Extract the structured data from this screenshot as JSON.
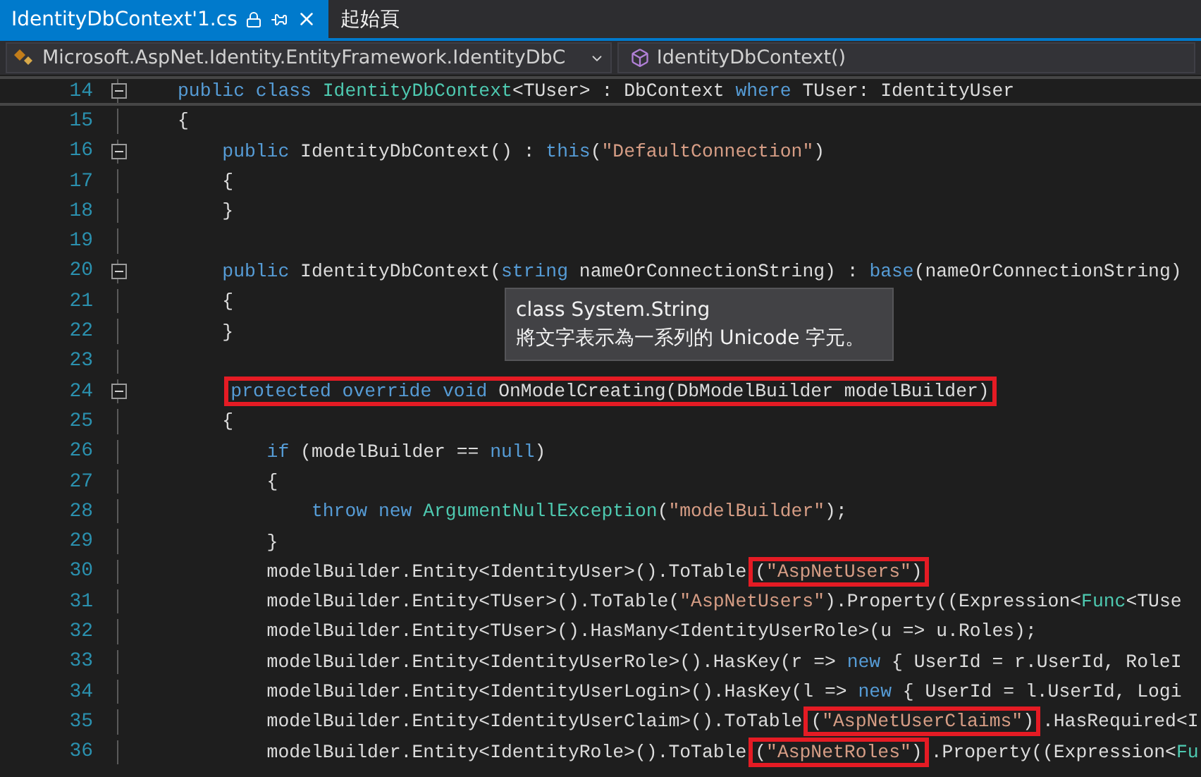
{
  "tabs": [
    {
      "label": "IdentityDbContext'1.cs",
      "selected": true
    },
    {
      "label": "起始頁",
      "selected": false
    }
  ],
  "navigation_bar": {
    "scope": "Microsoft.AspNet.Identity.EntityFramework.IdentityDbC",
    "member": "IdentityDbContext()"
  },
  "lines": [
    {
      "number": "14",
      "foldable": true,
      "current": true,
      "segments": [
        {
          "kind": "text",
          "tokens": [
            {
              "kind": "keyword",
              "text": "public class "
            },
            {
              "kind": "type",
              "text": "IdentityDbContext"
            },
            {
              "kind": "plain",
              "text": "<TUser> : DbContext "
            },
            {
              "kind": "keyword",
              "text": "where"
            },
            {
              "kind": "plain",
              "text": " TUser: IdentityUser"
            }
          ]
        }
      ]
    },
    {
      "number": "15",
      "foldable": false,
      "current": false,
      "segments": [
        {
          "kind": "text",
          "tokens": [
            {
              "kind": "plain",
              "text": "{"
            }
          ]
        }
      ]
    },
    {
      "number": "16",
      "foldable": true,
      "current": false,
      "segments": [
        {
          "kind": "text",
          "tokens": [
            {
              "kind": "keyword",
              "text": "    public"
            },
            {
              "kind": "plain",
              "text": " IdentityDbContext() : "
            },
            {
              "kind": "keyword",
              "text": "this"
            },
            {
              "kind": "plain",
              "text": "("
            },
            {
              "kind": "string",
              "text": "\"DefaultConnection\""
            },
            {
              "kind": "plain",
              "text": ")"
            }
          ]
        }
      ]
    },
    {
      "number": "17",
      "foldable": false,
      "current": false,
      "segments": [
        {
          "kind": "text",
          "tokens": [
            {
              "kind": "plain",
              "text": "    {"
            }
          ]
        }
      ]
    },
    {
      "number": "18",
      "foldable": false,
      "current": false,
      "segments": [
        {
          "kind": "text",
          "tokens": [
            {
              "kind": "plain",
              "text": "    }"
            }
          ]
        }
      ]
    },
    {
      "number": "19",
      "foldable": false,
      "current": false
    },
    {
      "number": "20",
      "foldable": true,
      "current": false,
      "segments": [
        {
          "kind": "text",
          "tokens": [
            {
              "kind": "keyword",
              "text": "    public"
            },
            {
              "kind": "plain",
              "text": " IdentityDbContext("
            },
            {
              "kind": "keyword",
              "text": "string"
            },
            {
              "kind": "plain",
              "text": " nameOrConnectionString) : "
            },
            {
              "kind": "keyword",
              "text": "base"
            },
            {
              "kind": "plain",
              "text": "(nameOrConnectionString)"
            }
          ]
        }
      ]
    },
    {
      "number": "21",
      "foldable": false,
      "current": false,
      "segments": [
        {
          "kind": "text",
          "tokens": [
            {
              "kind": "plain",
              "text": "    {"
            }
          ]
        }
      ]
    },
    {
      "number": "22",
      "foldable": false,
      "current": false,
      "segments": [
        {
          "kind": "text",
          "tokens": [
            {
              "kind": "plain",
              "text": "    }"
            }
          ]
        }
      ]
    },
    {
      "number": "23",
      "foldable": false,
      "current": false
    },
    {
      "number": "24",
      "foldable": true,
      "current": false,
      "segments": [
        {
          "kind": "highlight",
          "tokens": [
            {
              "kind": "keyword",
              "text": "    protected override void"
            },
            {
              "kind": "plain",
              "text": " OnModelCreating(DbModelBuilder modelBuilder)"
            }
          ]
        }
      ]
    },
    {
      "number": "25",
      "foldable": false,
      "current": false,
      "segments": [
        {
          "kind": "text",
          "tokens": [
            {
              "kind": "plain",
              "text": "    {"
            }
          ]
        }
      ]
    },
    {
      "number": "26",
      "foldable": false,
      "current": false,
      "segments": [
        {
          "kind": "text",
          "tokens": [
            {
              "kind": "keyword",
              "text": "        if"
            },
            {
              "kind": "plain",
              "text": " (modelBuilder == "
            },
            {
              "kind": "keyword",
              "text": "null"
            },
            {
              "kind": "plain",
              "text": ")"
            }
          ]
        }
      ]
    },
    {
      "number": "27",
      "foldable": false,
      "current": false,
      "segments": [
        {
          "kind": "text",
          "tokens": [
            {
              "kind": "plain",
              "text": "        {"
            }
          ]
        }
      ]
    },
    {
      "number": "28",
      "foldable": false,
      "current": false,
      "segments": [
        {
          "kind": "text",
          "tokens": [
            {
              "kind": "keyword",
              "text": "            throw new "
            },
            {
              "kind": "type",
              "text": "ArgumentNullException"
            },
            {
              "kind": "plain",
              "text": "("
            },
            {
              "kind": "string",
              "text": "\"modelBuilder\""
            },
            {
              "kind": "plain",
              "text": ");"
            }
          ]
        }
      ]
    },
    {
      "number": "29",
      "foldable": false,
      "current": false,
      "segments": [
        {
          "kind": "text",
          "tokens": [
            {
              "kind": "plain",
              "text": "        }"
            }
          ]
        }
      ]
    },
    {
      "number": "30",
      "foldable": false,
      "current": false,
      "segments": [
        {
          "kind": "text",
          "tokens": [
            {
              "kind": "plain",
              "text": "        modelBuilder.Entity<IdentityUser>().ToTable"
            }
          ]
        },
        {
          "kind": "highlight",
          "tokens": [
            {
              "kind": "plain",
              "text": "("
            },
            {
              "kind": "string",
              "text": "\"AspNetUsers\""
            },
            {
              "kind": "plain",
              "text": ")"
            }
          ]
        }
      ]
    },
    {
      "number": "31",
      "foldable": false,
      "current": false,
      "segments": [
        {
          "kind": "text",
          "tokens": [
            {
              "kind": "plain",
              "text": "        modelBuilder.Entity<TUser>().ToTable("
            },
            {
              "kind": "string",
              "text": "\"AspNetUsers\""
            },
            {
              "kind": "plain",
              "text": ").Property((Expression<"
            },
            {
              "kind": "type",
              "text": "Func"
            },
            {
              "kind": "plain",
              "text": "<TUse"
            }
          ]
        }
      ]
    },
    {
      "number": "32",
      "foldable": false,
      "current": false,
      "segments": [
        {
          "kind": "text",
          "tokens": [
            {
              "kind": "plain",
              "text": "        modelBuilder.Entity<TUser>().HasMany<IdentityUserRole>(u => u.Roles);"
            }
          ]
        }
      ]
    },
    {
      "number": "33",
      "foldable": false,
      "current": false,
      "segments": [
        {
          "kind": "text",
          "tokens": [
            {
              "kind": "plain",
              "text": "        modelBuilder.Entity<IdentityUserRole>().HasKey(r => "
            },
            {
              "kind": "keyword",
              "text": "new"
            },
            {
              "kind": "plain",
              "text": " { UserId = r.UserId, RoleI"
            }
          ]
        }
      ]
    },
    {
      "number": "34",
      "foldable": false,
      "current": false,
      "segments": [
        {
          "kind": "text",
          "tokens": [
            {
              "kind": "plain",
              "text": "        modelBuilder.Entity<IdentityUserLogin>().HasKey(l => "
            },
            {
              "kind": "keyword",
              "text": "new"
            },
            {
              "kind": "plain",
              "text": " { UserId = l.UserId, Logi"
            }
          ]
        }
      ]
    },
    {
      "number": "35",
      "foldable": false,
      "current": false,
      "segments": [
        {
          "kind": "text",
          "tokens": [
            {
              "kind": "plain",
              "text": "        modelBuilder.Entity<IdentityUserClaim>().ToTable"
            }
          ]
        },
        {
          "kind": "highlight",
          "tokens": [
            {
              "kind": "plain",
              "text": "("
            },
            {
              "kind": "string",
              "text": "\"AspNetUserClaims\""
            },
            {
              "kind": "plain",
              "text": ")"
            }
          ]
        },
        {
          "kind": "text",
          "tokens": [
            {
              "kind": "plain",
              "text": ".HasRequired<I"
            }
          ]
        }
      ]
    },
    {
      "number": "36",
      "foldable": false,
      "current": false,
      "segments": [
        {
          "kind": "text",
          "tokens": [
            {
              "kind": "plain",
              "text": "        modelBuilder.Entity<IdentityRole>().ToTable"
            }
          ]
        },
        {
          "kind": "highlight",
          "tokens": [
            {
              "kind": "plain",
              "text": "("
            },
            {
              "kind": "string",
              "text": "\"AspNetRoles\""
            },
            {
              "kind": "plain",
              "text": ")"
            }
          ]
        },
        {
          "kind": "text",
          "tokens": [
            {
              "kind": "plain",
              "text": ".Property((Expression<"
            },
            {
              "kind": "type",
              "text": "Fu"
            }
          ]
        }
      ]
    }
  ],
  "tooltip": {
    "title": "class System.String",
    "description": "將文字表示為一系列的 Unicode 字元。"
  }
}
